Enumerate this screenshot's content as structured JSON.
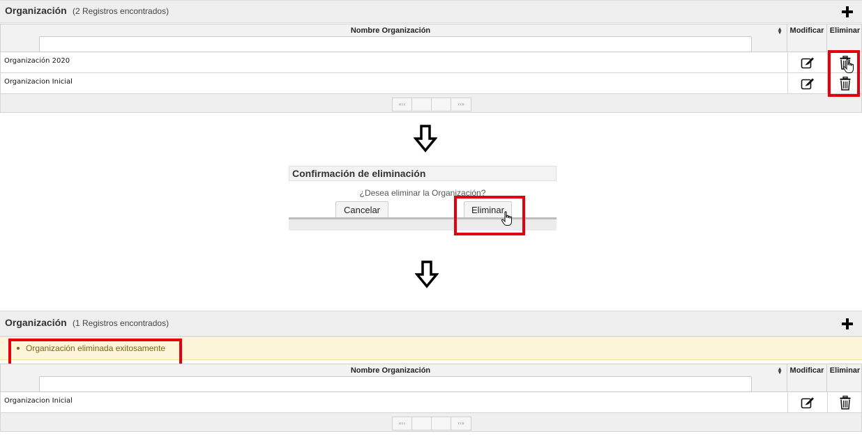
{
  "top_panel": {
    "title": "Organización",
    "count": "(2 Registros encontrados)"
  },
  "bottom_panel": {
    "title": "Organización",
    "count": "(1 Registros encontrados)"
  },
  "grid_headers": {
    "name": "Nombre Organización",
    "modify": "Modificar",
    "delete": "Eliminar"
  },
  "top_rows": [
    {
      "name": "Organización 2020"
    },
    {
      "name": "Organizacion Inicial"
    }
  ],
  "bottom_rows": [
    {
      "name": "Organizacion Inicial"
    }
  ],
  "pager": {
    "first": "«‹‹",
    "last": "››»"
  },
  "dialog": {
    "title": "Confirmación de eliminación",
    "message": "¿Desea eliminar la Organización?",
    "cancel_label": "Cancelar",
    "confirm_label": "Eliminar"
  },
  "success_message": "Organización eliminada exitosamente",
  "colors": {
    "highlight": "#e3000f",
    "message_bg": "#fcf5d9",
    "message_text": "#7a6414"
  },
  "icons": [
    "plus-icon",
    "sort-icon",
    "edit-icon",
    "trash-icon",
    "down-arrow-icon",
    "hand-cursor-icon"
  ]
}
